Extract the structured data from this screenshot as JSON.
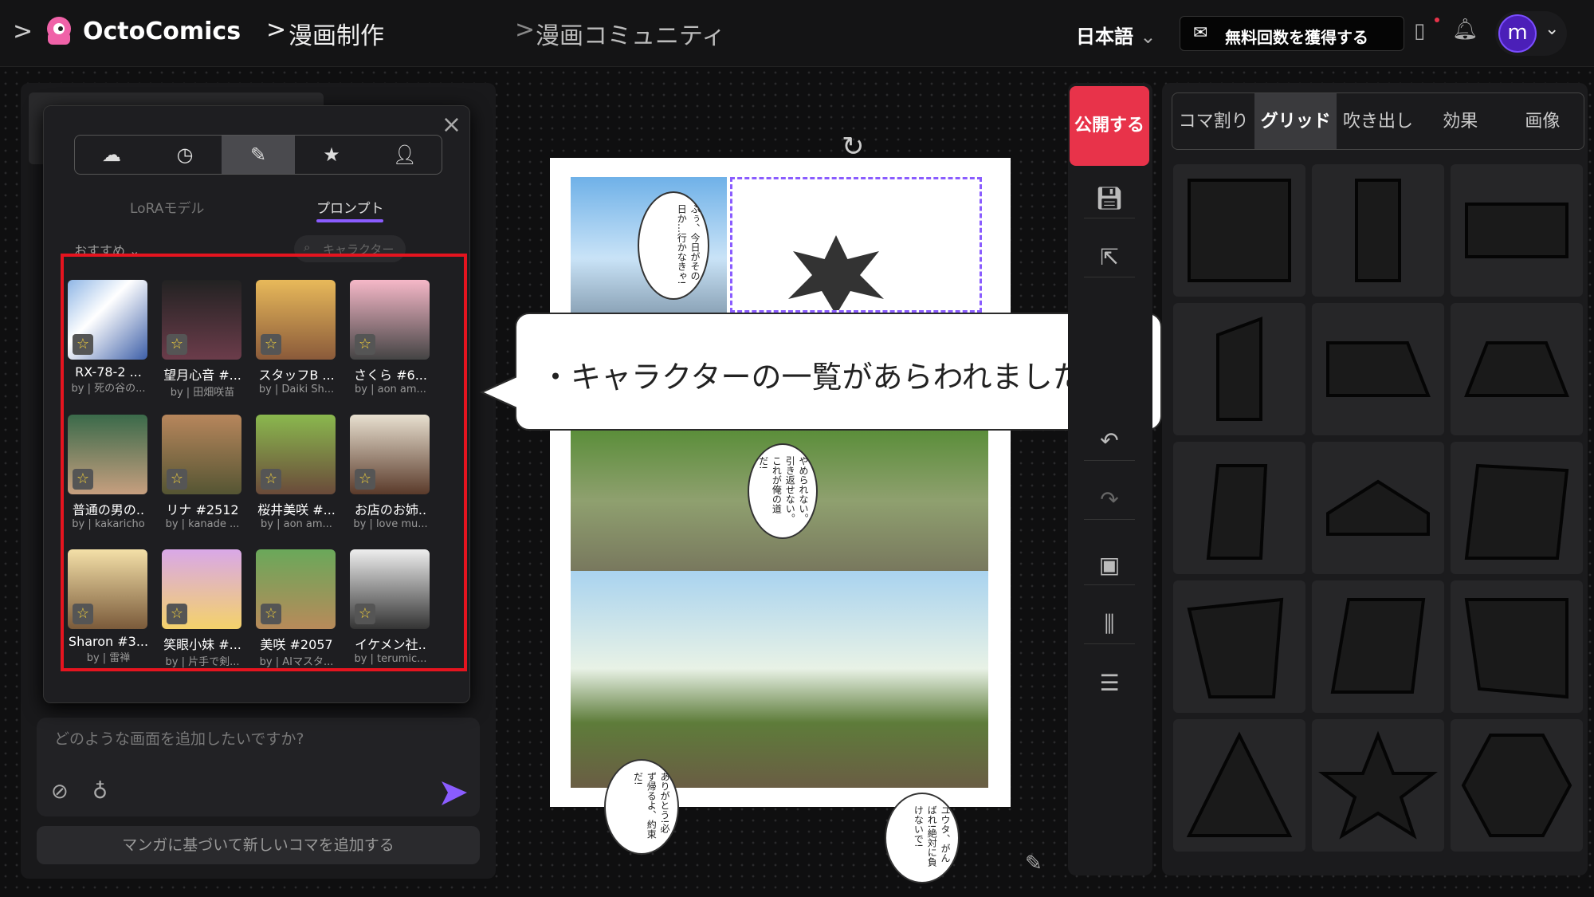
{
  "header": {
    "logo": "OctoComics",
    "crumb1": "漫画制作",
    "crumb2": "漫画コミュニティ",
    "language": "日本語",
    "gift_button": "無料回数を獲得する",
    "avatar_letter": "m"
  },
  "left": {
    "prompt_placeholder": "どのような画面を追加したいですか?",
    "add_button": "マンガに基づいて新しいコマを追加する"
  },
  "popup": {
    "tab_lora": "LoRAモデル",
    "tab_prompt": "プロンプト",
    "sort": "おすすめ",
    "search_placeholder": "キャラクター",
    "characters": [
      {
        "name": "RX-78-2 ...",
        "by": "by | 死の谷の..."
      },
      {
        "name": "望月心音 #...",
        "by": "by | 田畑咲苗"
      },
      {
        "name": "スタッフB ...",
        "by": "by | Daiki Sh..."
      },
      {
        "name": "さくら #6...",
        "by": "by | aon am..."
      },
      {
        "name": "普通の男の..",
        "by": "by | kakaricho"
      },
      {
        "name": "リナ #2512",
        "by": "by | kanade ..."
      },
      {
        "name": "桜井美咲 #...",
        "by": "by | aon am..."
      },
      {
        "name": "お店のお姉..",
        "by": "by | love mu..."
      },
      {
        "name": "Sharon #3...",
        "by": "by | 雷禅"
      },
      {
        "name": "笑眼小妹 #...",
        "by": "by | 片手で剣..."
      },
      {
        "name": "美咲 #2057",
        "by": "by | AIマスタ..."
      },
      {
        "name": "イケメン社..",
        "by": "by | terumic..."
      }
    ]
  },
  "canvas": {
    "bubble1": "ふぅ、今日がその日か…行かなきゃ!",
    "bubble2": "やめられない。引き返せない。これが俺の道だ!",
    "bubble3": "ありがとう!必ず帰るよ、約束だ!",
    "bubble4": "ユウタ、がんばれ!絶対に負けないで!"
  },
  "callout": "・キャラクターの一覧があらわれました",
  "tools": {
    "publish": "公開する"
  },
  "right": {
    "tabs": [
      "コマ割り",
      "グリッド",
      "吹き出し",
      "効果",
      "画像"
    ],
    "active_tab": "グリッド"
  },
  "colors": {
    "accent": "#8a5cff",
    "publish": "#e8334a",
    "highlight": "#e5141f"
  }
}
